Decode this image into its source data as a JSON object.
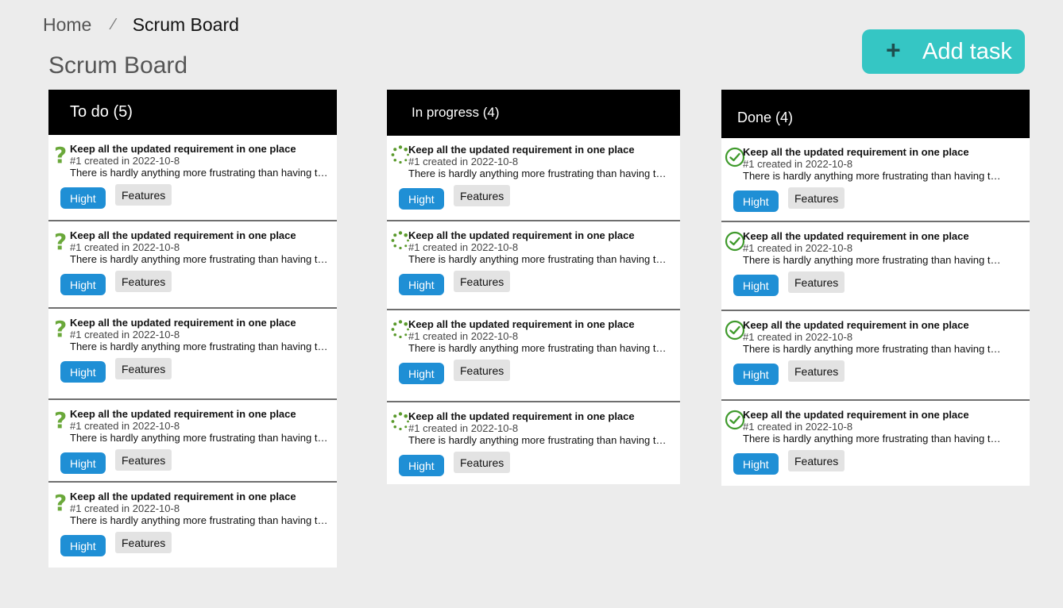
{
  "breadcrumb": {
    "home": "Home",
    "separator": "⁄",
    "current": "Scrum Board"
  },
  "page_title": "Scrum Board",
  "add_task": {
    "icon": "plus-icon",
    "label": "Add task",
    "color": "#35c6c4"
  },
  "columns": [
    {
      "title": "To do (5)",
      "status_icon": "question-icon",
      "cards": [
        {
          "title": "Keep all the updated requirement in one place",
          "meta": "#1 created in 2022-10-8",
          "description": "There is hardly anything more frustrating than  having to look",
          "priority": "Hight",
          "type": "Features"
        },
        {
          "title": "Keep all the updated requirement in one place",
          "meta": "#1 created in 2022-10-8",
          "description": "There is hardly anything more frustrating than  having to look",
          "priority": "Hight",
          "type": "Features"
        },
        {
          "title": "Keep all the updated requirement in one place",
          "meta": "#1 created in 2022-10-8",
          "description": "There is hardly anything more frustrating than  having to look",
          "priority": "Hight",
          "type": "Features"
        },
        {
          "title": "Keep all the updated requirement in one place",
          "meta": "#1 created in 2022-10-8",
          "description": "There is hardly anything more frustrating than  having to look",
          "priority": "Hight",
          "type": "Features"
        },
        {
          "title": "Keep all the updated requirement in one place",
          "meta": "#1 created in 2022-10-8",
          "description": "There is hardly anything more frustrating than  having to look",
          "priority": "Hight",
          "type": "Features"
        }
      ]
    },
    {
      "title": "In progress (4)",
      "status_icon": "spinner-icon",
      "cards": [
        {
          "title": "Keep all the updated requirement in one place",
          "meta": "#1 created in 2022-10-8",
          "description": "There is hardly anything more frustrating than  having to look",
          "priority": "Hight",
          "type": "Features"
        },
        {
          "title": "Keep all the updated requirement in one place",
          "meta": "#1 created in 2022-10-8",
          "description": "There is hardly anything more frustrating than  having to look",
          "priority": "Hight",
          "type": "Features"
        },
        {
          "title": "Keep all the updated requirement in one place",
          "meta": "#1 created in 2022-10-8",
          "description": "There is hardly anything more frustrating than  having to look",
          "priority": "Hight",
          "type": "Features"
        },
        {
          "title": "Keep all the updated requirement in one place",
          "meta": "#1 created in 2022-10-8",
          "description": "There is hardly anything more frustrating than  having to look",
          "priority": "Hight",
          "type": "Features"
        }
      ]
    },
    {
      "title": "Done  (4)",
      "status_icon": "check-circle-icon",
      "cards": [
        {
          "title": "Keep all the updated requirement in one place",
          "meta": "#1 created in 2022-10-8",
          "description": "There is hardly anything more frustrating than  having to look",
          "priority": "Hight",
          "type": "Features"
        },
        {
          "title": "Keep all the updated requirement in one place",
          "meta": "#1 created in 2022-10-8",
          "description": "There is hardly anything more frustrating than  having to look",
          "priority": "Hight",
          "type": "Features"
        },
        {
          "title": "Keep all the updated requirement in one place",
          "meta": "#1 created in 2022-10-8",
          "description": "There is hardly anything more frustrating than  having to look",
          "priority": "Hight",
          "type": "Features"
        },
        {
          "title": "Keep all the updated requirement in one place",
          "meta": "#1 created in 2022-10-8",
          "description": "There is hardly anything more frustrating than  having to look",
          "priority": "Hight",
          "type": "Features"
        }
      ]
    }
  ],
  "colors": {
    "priority": "#1f8fd5",
    "status_icon": "#5a9a2c",
    "header": "#000000"
  }
}
